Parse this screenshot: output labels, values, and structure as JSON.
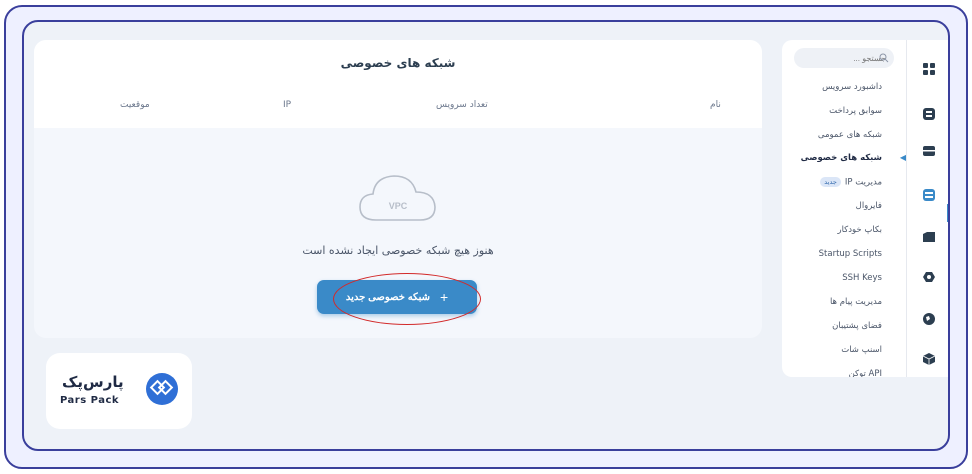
{
  "main": {
    "title": "شبکه های خصوصی",
    "columns": [
      "نام",
      "تعداد سرویس",
      "IP",
      "موقعیت"
    ],
    "cloud_label": "VPC",
    "empty_text": "هنوز هیچ شبکه خصوصی ایجاد نشده است",
    "new_button_label": "شبکه خصوصی جدید"
  },
  "logo": {
    "fa": "پارس‌پک",
    "en": "Pars Pack"
  },
  "sidebar": {
    "search_placeholder": "جستجو ...",
    "items": [
      {
        "label": "داشبورد سرویس"
      },
      {
        "label": "سوابق پرداخت"
      },
      {
        "label": "شبکه های عمومی"
      },
      {
        "label": "شبکه های خصوصی",
        "active": true
      },
      {
        "label": "مدیریت IP",
        "badge": "جدید"
      },
      {
        "label": "فایروال"
      },
      {
        "label": "بکاپ خودکار"
      },
      {
        "label": "Startup Scripts"
      },
      {
        "label": "SSH Keys"
      },
      {
        "label": "مدیریت پیام ها"
      },
      {
        "label": "فضای پشتیبان"
      },
      {
        "label": "اسنپ شات"
      },
      {
        "label": "API توکن"
      }
    ]
  },
  "rail": {
    "icons": [
      "grid-icon",
      "billing-icon",
      "server-icon",
      "network-icon",
      "storage-icon",
      "security-icon",
      "globe-icon",
      "box-icon"
    ]
  },
  "colors": {
    "accent": "#3a8ac8",
    "frame": "#3a3f9c",
    "highlight": "#d22a2a"
  }
}
